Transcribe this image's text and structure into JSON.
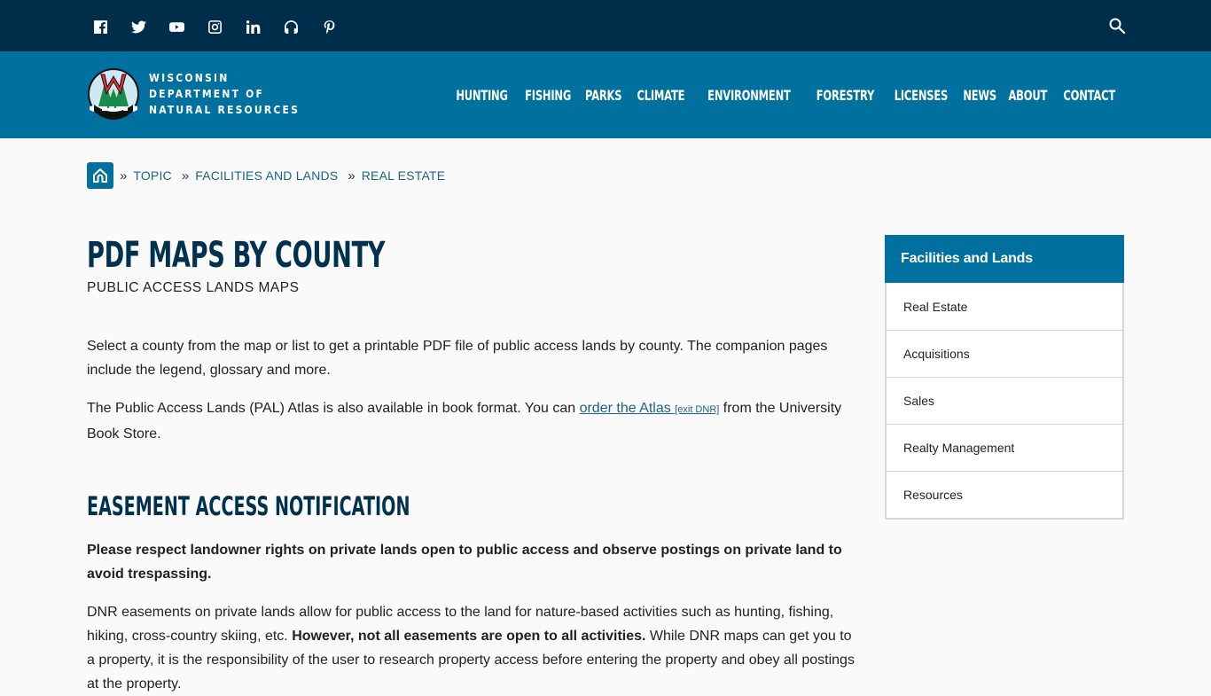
{
  "topbar": {
    "social": [
      {
        "name": "facebook-icon",
        "label": "Facebook"
      },
      {
        "name": "twitter-icon",
        "label": "Twitter"
      },
      {
        "name": "youtube-icon",
        "label": "YouTube"
      },
      {
        "name": "instagram-icon",
        "label": "Instagram"
      },
      {
        "name": "linkedin-icon",
        "label": "LinkedIn"
      },
      {
        "name": "podcast-icon",
        "label": "Podcast"
      },
      {
        "name": "pinterest-icon",
        "label": "Pinterest"
      }
    ],
    "search_label": "Search"
  },
  "logo": {
    "line1": "Wisconsin",
    "line2": "Department of",
    "line3": "Natural Resources"
  },
  "nav": {
    "items": [
      "HUNTING",
      "FISHING",
      "PARKS",
      "CLIMATE",
      "ENVIRONMENT",
      "FORESTRY",
      "LICENSES",
      "NEWS",
      "ABOUT",
      "CONTACT"
    ]
  },
  "breadcrumb": {
    "separator": "»",
    "items": [
      "TOPIC",
      "FACILITIES AND LANDS",
      "REAL ESTATE"
    ]
  },
  "main": {
    "title": "PDF MAPS BY COUNTY",
    "subtitle": "PUBLIC ACCESS LANDS MAPS",
    "p1": "Select a county from the map or list to get a printable PDF file of public access lands by county. The companion pages include the legend, glossary and more.",
    "p2_before": "The Public Access Lands (PAL) Atlas is also available in book format. You can ",
    "p2_link": "order the Atlas ",
    "p2_exit": "[exit DNR]",
    "p2_after": " from the University Book Store.",
    "h2": "EASEMENT ACCESS NOTIFICATION",
    "p3": "Please respect landowner rights on private lands open to public access and observe postings on private land to avoid trespassing.",
    "p4_before": "DNR easements on private lands allow for public access to the land for nature-based activities such as hunting, fishing, hiking, cross-country skiing, etc. ",
    "p4_bold": "However, not all easements are open to all activities.",
    "p4_after": " While DNR maps can get you to a property, it is the responsibility of the user to research property access before entering the property and obey all postings at the property."
  },
  "sidebar": {
    "heading": "Facilities and Lands",
    "items": [
      "Real Estate",
      "Acquisitions",
      "Sales",
      "Realty Management",
      "Resources"
    ]
  },
  "colors": {
    "topbar": "#002e4a",
    "nav": "#00719e",
    "heading": "#00324f",
    "link": "#19648a"
  }
}
